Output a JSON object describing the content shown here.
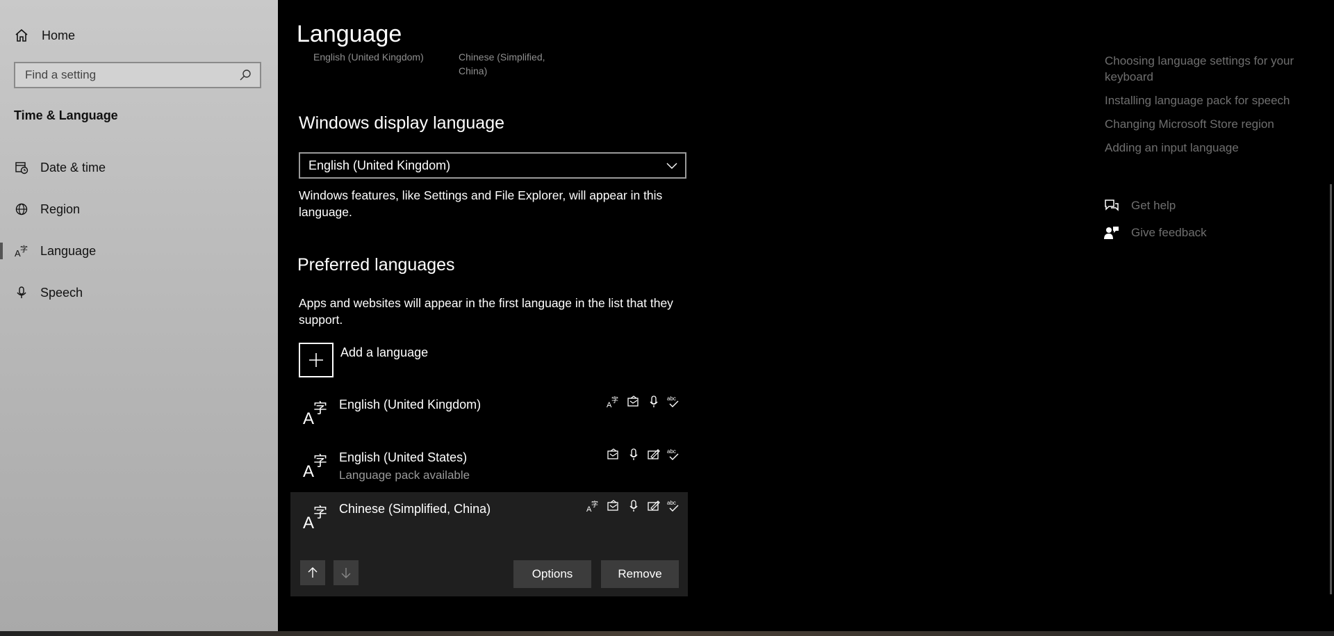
{
  "sidebar": {
    "home_label": "Home",
    "search_placeholder": "Find a setting",
    "section_title": "Time & Language",
    "items": [
      {
        "label": "Date & time",
        "icon": "calendar-clock-icon"
      },
      {
        "label": "Region",
        "icon": "globe-icon"
      },
      {
        "label": "Language",
        "icon": "language-icon",
        "active": true
      },
      {
        "label": "Speech",
        "icon": "microphone-icon"
      }
    ]
  },
  "main": {
    "title": "Language",
    "top_faded": {
      "left": "English (United Kingdom)",
      "right_line1": "Chinese (Simplified,",
      "right_line2": "China)"
    },
    "display_language": {
      "heading": "Windows display language",
      "selected": "English (United Kingdom)",
      "description": "Windows features, like Settings and File Explorer, will appear in this language."
    },
    "preferred": {
      "heading": "Preferred languages",
      "description": "Apps and websites will appear in the first language in the list that they support.",
      "add_label": "Add a language",
      "languages": [
        {
          "name": "English (United Kingdom)",
          "sub": "",
          "features": [
            "display-language-icon",
            "text-to-speech-icon",
            "speech-recognition-icon",
            "spell-check-icon"
          ]
        },
        {
          "name": "English (United States)",
          "sub": "Language pack available",
          "features": [
            "text-to-speech-icon",
            "speech-recognition-icon",
            "handwriting-icon",
            "spell-check-icon"
          ]
        },
        {
          "name": "Chinese (Simplified, China)",
          "sub": "",
          "features": [
            "display-language-icon",
            "text-to-speech-icon",
            "speech-recognition-icon",
            "handwriting-icon",
            "spell-check-icon"
          ]
        }
      ],
      "options_label": "Options",
      "remove_label": "Remove"
    }
  },
  "related": {
    "links": [
      "Choosing language settings for your keyboard",
      "Installing language pack for speech",
      "Changing Microsoft Store region",
      "Adding an input language"
    ],
    "get_help": "Get help",
    "give_feedback": "Give feedback"
  }
}
